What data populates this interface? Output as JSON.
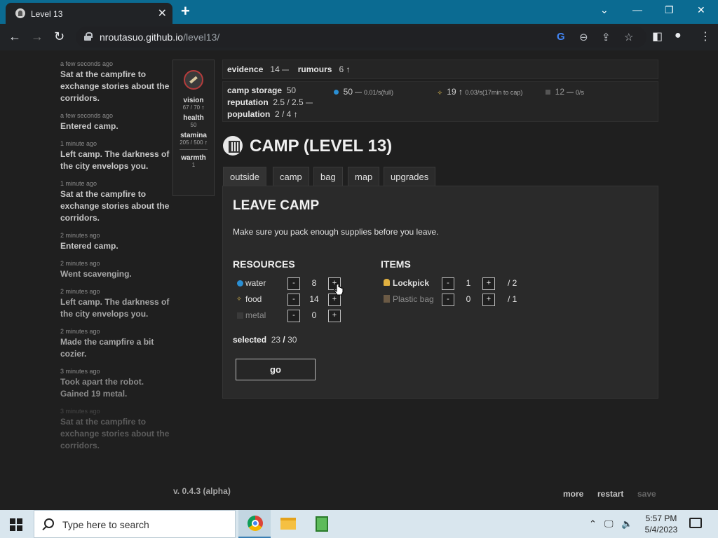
{
  "browser": {
    "tab_title": "Level 13",
    "url_host": "nroutasuo.github.io",
    "url_path": "/level13/"
  },
  "log": [
    {
      "time": "a few seconds ago",
      "text": "Sat at the campfire to exchange stories about the corridors."
    },
    {
      "time": "a few seconds ago",
      "text": "Entered camp."
    },
    {
      "time": "1 minute ago",
      "text": "Left camp. The darkness of the city envelops you."
    },
    {
      "time": "1 minute ago",
      "text": "Sat at the campfire to exchange stories about the corridors."
    },
    {
      "time": "2 minutes ago",
      "text": "Entered camp."
    },
    {
      "time": "2 minutes ago",
      "text": "Went scavenging."
    },
    {
      "time": "2 minutes ago",
      "text": "Left camp. The darkness of the city envelops you."
    },
    {
      "time": "2 minutes ago",
      "text": "Made the campfire a bit cozier."
    },
    {
      "time": "3 minutes ago",
      "text": "Took apart the robot. Gained 19 metal."
    },
    {
      "time": "3 minutes ago",
      "text": "Sat at the campfire to exchange stories about the corridors."
    }
  ],
  "stats": {
    "vision_label": "vision",
    "vision_val": "67 / 70",
    "health_label": "health",
    "health_val": "50",
    "stamina_label": "stamina",
    "stamina_val": "205 / 500",
    "warmth_label": "warmth",
    "warmth_val": "1"
  },
  "status": {
    "evidence_label": "evidence",
    "evidence_val": "14",
    "rumours_label": "rumours",
    "rumours_val": "6",
    "storage_label": "camp storage",
    "storage_val": "50",
    "reputation_label": "reputation",
    "reputation_val": "2.5 / 2.5",
    "population_label": "population",
    "population_val": "2 / 4",
    "water_amount": "50",
    "water_rate": "0.01/s(full)",
    "food_amount": "19",
    "food_rate": "0.03/s(17min to cap)",
    "metal_amount": "12",
    "metal_rate": "0/s"
  },
  "camp": {
    "title": "CAMP (LEVEL 13)",
    "tabs": [
      "outside",
      "camp",
      "bag",
      "map",
      "upgrades"
    ]
  },
  "leave": {
    "heading": "LEAVE CAMP",
    "desc": "Make sure you pack enough supplies before you leave.",
    "resources_heading": "RESOURCES",
    "items_heading": "ITEMS",
    "resources": [
      {
        "name": "water",
        "value": "8"
      },
      {
        "name": "food",
        "value": "14"
      },
      {
        "name": "metal",
        "value": "0"
      }
    ],
    "items": [
      {
        "name": "Lockpick",
        "value": "1",
        "cap": "/ 2"
      },
      {
        "name": "Plastic bag",
        "value": "0",
        "cap": "/ 1"
      }
    ],
    "minus": "-",
    "plus": "+",
    "selected_label": "selected",
    "selected_val": "23",
    "selected_sep": "/",
    "selected_max": "30",
    "go": "go"
  },
  "footer": {
    "version": "v. 0.4.3 (alpha)",
    "more": "more",
    "restart": "restart",
    "save": "save"
  },
  "taskbar": {
    "search_placeholder": "Type here to search",
    "time": "5:57 PM",
    "date": "5/4/2023"
  },
  "colors": {
    "accent": "#0b6b92",
    "water": "#2a8fd4",
    "food": "#c8a84a",
    "lock": "#e0b040"
  }
}
